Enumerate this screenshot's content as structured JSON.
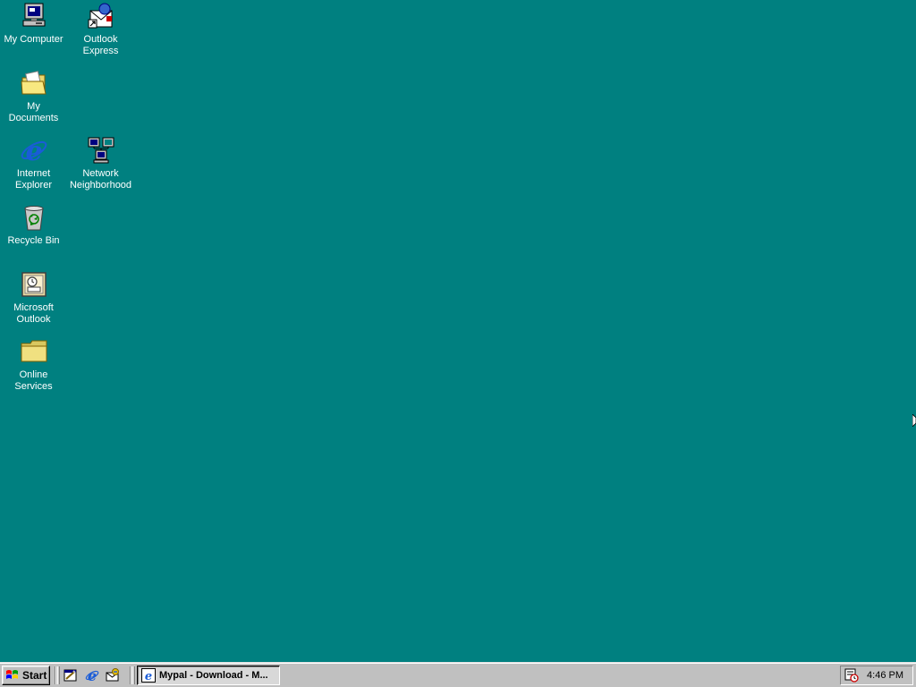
{
  "desktop": {
    "background_color": "#008080",
    "icons": [
      {
        "label": "My Computer",
        "icon": "my-computer-icon"
      },
      {
        "label": "Outlook Express",
        "icon": "outlook-express-icon"
      },
      {
        "label": "My Documents",
        "icon": "my-documents-icon"
      },
      {
        "label": "Internet Explorer",
        "icon": "internet-explorer-icon"
      },
      {
        "label": "Network Neighborhood",
        "icon": "network-neighborhood-icon"
      },
      {
        "label": "Recycle Bin",
        "icon": "recycle-bin-icon"
      },
      {
        "label": "Microsoft Outlook",
        "icon": "microsoft-outlook-icon"
      },
      {
        "label": "Online Services",
        "icon": "online-services-icon"
      }
    ]
  },
  "taskbar": {
    "start_label": "Start",
    "quick_launch": [
      {
        "icon": "show-desktop-icon"
      },
      {
        "icon": "internet-explorer-icon"
      },
      {
        "icon": "outlook-express-icon"
      }
    ],
    "tasks": [
      {
        "label": "Mypal - Download - M...",
        "icon": "internet-explorer-icon"
      }
    ],
    "tray": {
      "icons": [
        {
          "icon": "scheduler-icon"
        }
      ],
      "clock": "4:46 PM"
    }
  }
}
